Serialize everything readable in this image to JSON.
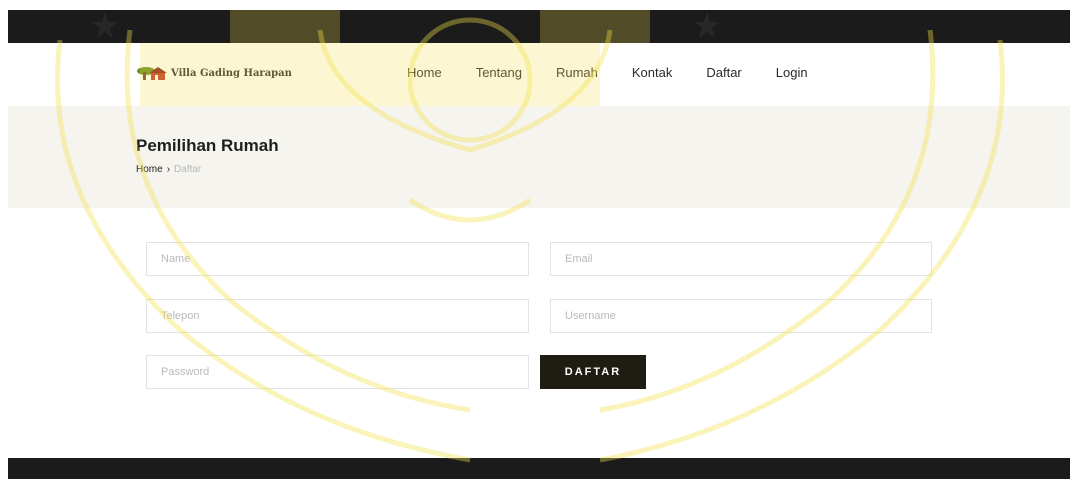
{
  "brand": {
    "name": "Villa Gading Harapan"
  },
  "nav": [
    {
      "label": "Home"
    },
    {
      "label": "Tentang"
    },
    {
      "label": "Rumah"
    },
    {
      "label": "Kontak"
    },
    {
      "label": "Daftar"
    },
    {
      "label": "Login"
    }
  ],
  "page": {
    "title": "Pemilihan Rumah"
  },
  "breadcrumb": {
    "home": "Home",
    "separator": "›",
    "current": "Daftar"
  },
  "form": {
    "name_placeholder": "Name",
    "email_placeholder": "Email",
    "phone_placeholder": "Telepon",
    "username_placeholder": "Username",
    "password_placeholder": "Password",
    "submit_label": "DAFTAR"
  },
  "colors": {
    "watermark": "#f2e04a",
    "dark": "#1b1b1b",
    "button": "#1f1c14"
  }
}
